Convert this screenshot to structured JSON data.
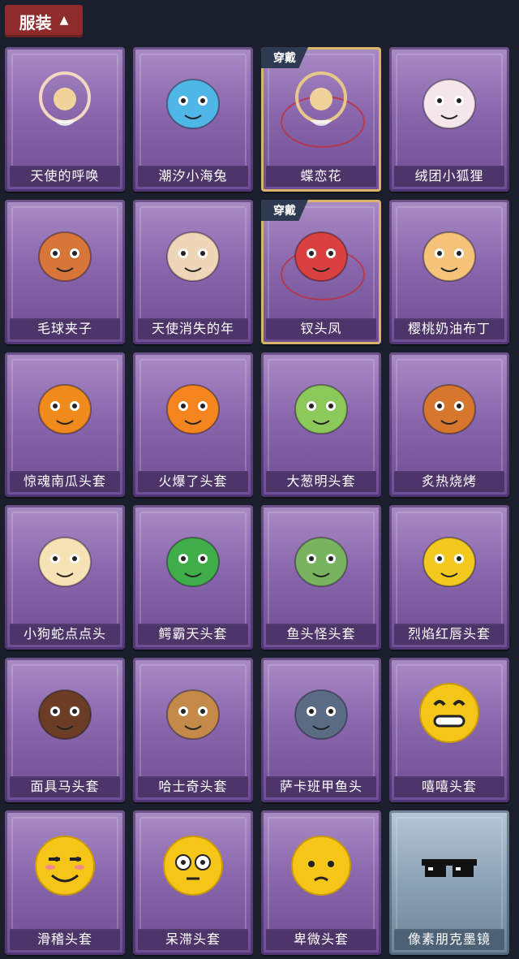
{
  "header": {
    "title": "服装"
  },
  "items": [
    {
      "label": "天使的呼唤",
      "icon": "angel-icon",
      "equipped": false,
      "color": "#f2d8c0"
    },
    {
      "label": "潮汐小海兔",
      "icon": "sea-bunny-icon",
      "equipped": false,
      "color": "#4fb6e8"
    },
    {
      "label": "蝶恋花",
      "icon": "flower-ring-icon",
      "equipped": true,
      "badge": "穿戴",
      "color": "#e6c98a"
    },
    {
      "label": "绒团小狐狸",
      "icon": "fox-icon",
      "equipped": false,
      "color": "#f4e6ea"
    },
    {
      "label": "毛球夹子",
      "icon": "raccoon-icon",
      "equipped": false,
      "color": "#d8763a"
    },
    {
      "label": "天使消失的年",
      "icon": "angel-girl-icon",
      "equipped": false,
      "color": "#f0d6b8"
    },
    {
      "label": "钗头凤",
      "icon": "phoenix-crown-icon",
      "equipped": true,
      "badge": "穿戴",
      "color": "#d94040"
    },
    {
      "label": "樱桃奶油布丁",
      "icon": "pudding-icon",
      "equipped": false,
      "color": "#f6c37a"
    },
    {
      "label": "惊魂南瓜头套",
      "icon": "pumpkin-icon",
      "equipped": false,
      "color": "#f08a1c"
    },
    {
      "label": "火爆了头套",
      "icon": "fire-icon",
      "equipped": false,
      "color": "#f5861f"
    },
    {
      "label": "大葱明头套",
      "icon": "scallion-icon",
      "equipped": false,
      "color": "#8cc95a"
    },
    {
      "label": "炙热烧烤",
      "icon": "bbq-icon",
      "equipped": false,
      "color": "#d7772e"
    },
    {
      "label": "小狗蛇点点头",
      "icon": "snake-icon",
      "equipped": false,
      "color": "#f6e2b4"
    },
    {
      "label": "鳄霸天头套",
      "icon": "crocodile-icon",
      "equipped": false,
      "color": "#3fae4a"
    },
    {
      "label": "鱼头怪头套",
      "icon": "fishhead-icon",
      "equipped": false,
      "color": "#78b460"
    },
    {
      "label": "烈焰红唇头套",
      "icon": "pikachu-icon",
      "equipped": false,
      "color": "#f2c91e"
    },
    {
      "label": "面具马头套",
      "icon": "horse-icon",
      "equipped": false,
      "color": "#6b3d26"
    },
    {
      "label": "哈士奇头套",
      "icon": "husky-icon",
      "equipped": false,
      "color": "#c48a4a"
    },
    {
      "label": "萨卡班甲鱼头",
      "icon": "fish-icon",
      "equipped": false,
      "color": "#5a6b84"
    },
    {
      "label": "嘻嘻头套",
      "icon": "grin-emoji-icon",
      "equipped": false,
      "color": "#f5c518"
    },
    {
      "label": "滑稽头套",
      "icon": "funny-emoji-icon",
      "equipped": false,
      "color": "#f5c518"
    },
    {
      "label": "呆滞头套",
      "icon": "stare-emoji-icon",
      "equipped": false,
      "color": "#f5c518"
    },
    {
      "label": "卑微头套",
      "icon": "humble-emoji-icon",
      "equipped": false,
      "color": "#f5c518"
    },
    {
      "label": "像素朋克墨镜",
      "icon": "pixel-sunglasses-icon",
      "equipped": false,
      "silver": true,
      "color": "#111111"
    }
  ]
}
